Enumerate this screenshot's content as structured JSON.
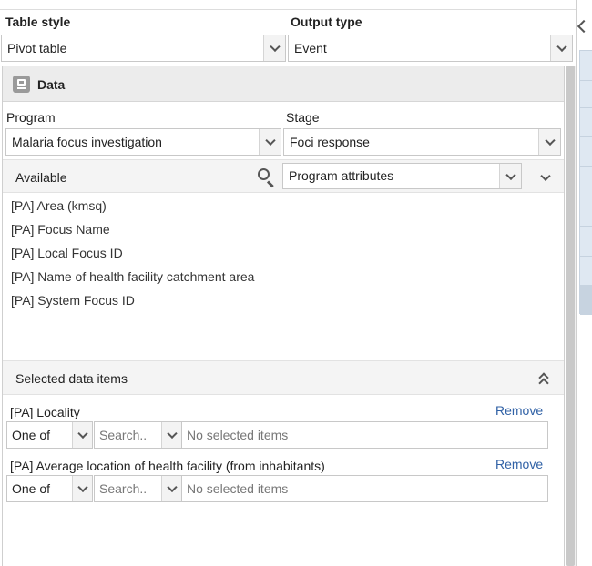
{
  "top": {
    "table_style_label": "Table style",
    "output_type_label": "Output type",
    "table_style_value": "Pivot table",
    "output_type_value": "Event"
  },
  "data_panel": {
    "title": "Data",
    "program_label": "Program",
    "stage_label": "Stage",
    "program_value": "Malaria focus investigation",
    "stage_value": "Foci response",
    "available_label": "Available",
    "filter_value": "Program attributes",
    "available_items": [
      "[PA] Area (kmsq)",
      "[PA] Focus Name",
      "[PA] Local Focus ID",
      "[PA] Name of health facility catchment area",
      "[PA] System Focus ID"
    ],
    "selected_header": "Selected data items",
    "selected_items": [
      {
        "label": "[PA] Locality",
        "remove": "Remove",
        "operator": "One of",
        "search_placeholder": "Search..",
        "selected_text": "No selected items"
      },
      {
        "label": "[PA] Average location of health facility (from inhabitants)",
        "remove": "Remove",
        "operator": "One of",
        "search_placeholder": "Search..",
        "selected_text": "No selected items"
      }
    ]
  },
  "colors": {
    "link": "#3162a6",
    "header_bg": "#ececec",
    "border": "#c8c8c8",
    "scrollbar": "#c9c9c9",
    "right_strip": "#d9e3ee"
  },
  "icons": [
    "data-panel-icon",
    "search-icon",
    "chevron-down-icon",
    "double-chevron-up-icon",
    "chevron-left-icon"
  ]
}
